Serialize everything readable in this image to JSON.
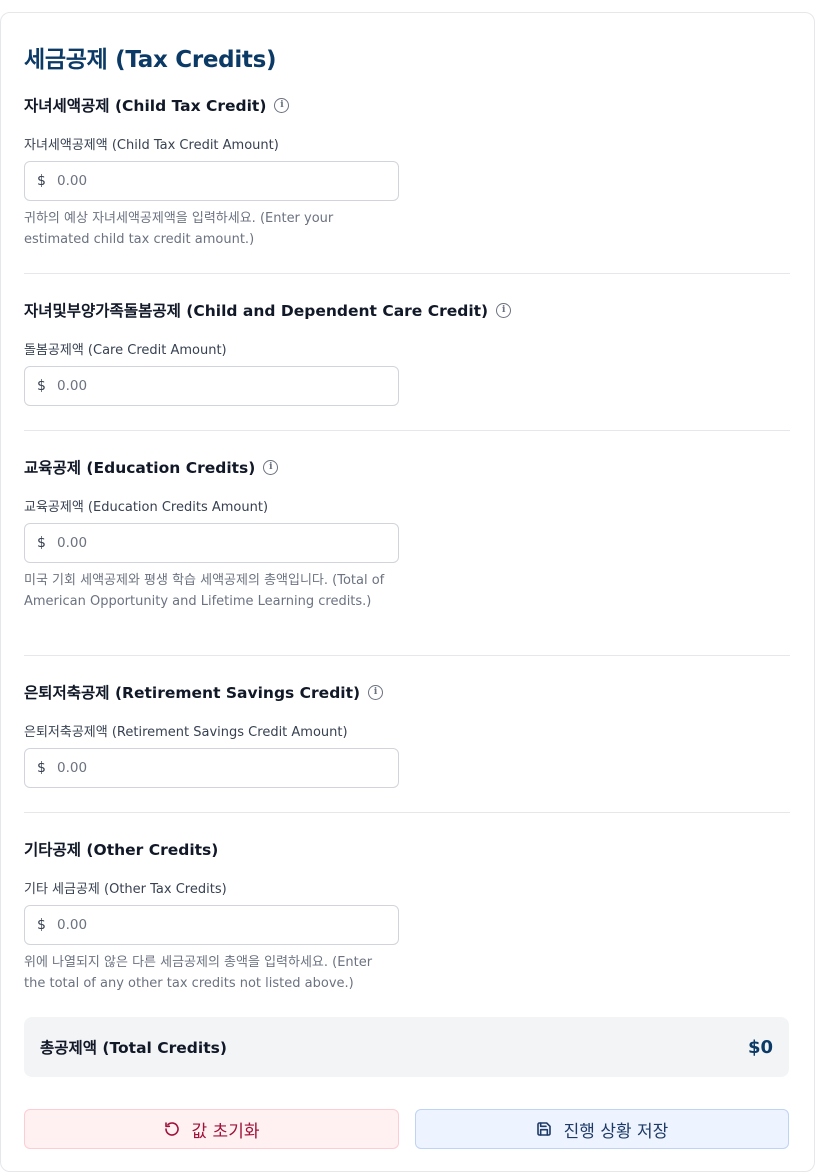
{
  "page": {
    "title": "세금공제 (Tax Credits)"
  },
  "sections": [
    {
      "heading": "자녀세액공제 (Child Tax Credit)",
      "info_icon": "info-icon",
      "field_label": "자녀세액공제액 (Child Tax Credit Amount)",
      "currency": "$",
      "placeholder": "0.00",
      "help": "귀하의 예상 자녀세액공제액을 입력하세요. (Enter your estimated child tax credit amount.)"
    },
    {
      "heading": "자녀및부양가족돌봄공제 (Child and Dependent Care Credit)",
      "info_icon": "info-icon",
      "field_label": "돌봄공제액 (Care Credit Amount)",
      "currency": "$",
      "placeholder": "0.00",
      "help": ""
    },
    {
      "heading": "교육공제 (Education Credits)",
      "info_icon": "info-icon",
      "field_label": "교육공제액 (Education Credits Amount)",
      "currency": "$",
      "placeholder": "0.00",
      "help": "미국 기회 세액공제와 평생 학습 세액공제의 총액입니다. (Total of American Opportunity and Lifetime Learning credits.)"
    },
    {
      "heading": "은퇴저축공제 (Retirement Savings Credit)",
      "info_icon": "info-icon",
      "field_label": "은퇴저축공제액 (Retirement Savings Credit Amount)",
      "currency": "$",
      "placeholder": "0.00",
      "help": ""
    },
    {
      "heading": "기타공제 (Other Credits)",
      "field_label": "기타 세금공제 (Other Tax Credits)",
      "currency": "$",
      "placeholder": "0.00",
      "help": "위에 나열되지 않은 다른 세금공제의 총액을 입력하세요. (Enter the total of any other tax credits not listed above.)"
    }
  ],
  "total": {
    "label": "총공제액 (Total Credits)",
    "value": "$0"
  },
  "buttons": {
    "reset_label": "값 초기화",
    "reset_icon": "rotate-ccw-icon",
    "save_label": "진행 상황 저장",
    "save_icon": "save-icon"
  },
  "colors": {
    "title": "#0b3a66",
    "reset_bg": "#fff1f2",
    "reset_text": "#9f1239",
    "save_bg": "#eef4ff",
    "save_text": "#1e3a66"
  }
}
